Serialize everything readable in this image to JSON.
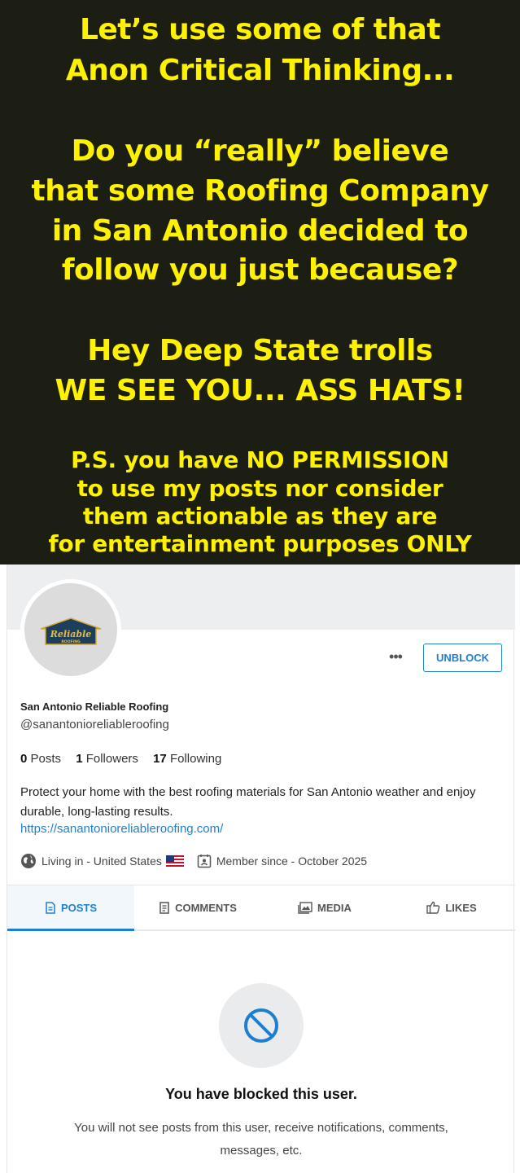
{
  "meme": {
    "line1": "Let’s use some of that",
    "line2": "Anon Critical Thinking...",
    "line3": "Do you “really” believe",
    "line4": "that some Roofing Company",
    "line5": "in San Antonio decided to",
    "line6": "follow you just because?",
    "line7": "Hey Deep State trolls",
    "line8": "WE SEE YOU... ASS HATS!",
    "line9": "P.S.  you have NO PERMISSION",
    "line10": "to use my posts nor consider",
    "line11": "them actionable as they are",
    "line12": "for entertainment purposes ONLY"
  },
  "profile": {
    "logo_text": "Reliable",
    "logo_subtext": "ROOFING",
    "more_label": "•••",
    "unblock_label": "UNBLOCK",
    "display_name": "San Antonio Reliable Roofing",
    "handle": "@sanantonioreliableroofing",
    "stats": {
      "posts_count": "0",
      "posts_label": "Posts",
      "followers_count": "1",
      "followers_label": "Followers",
      "following_count": "17",
      "following_label": "Following"
    },
    "bio": "Protect your home with the best roofing materials for San Antonio weather and enjoy durable, long-lasting results.",
    "website": "https://sanantonioreliableroofing.com/",
    "location": "Living in - United States",
    "member_since": "Member since - October 2025"
  },
  "tabs": [
    {
      "label": "POSTS",
      "icon": "document-icon",
      "active": true
    },
    {
      "label": "COMMENTS",
      "icon": "comment-doc-icon",
      "active": false
    },
    {
      "label": "MEDIA",
      "icon": "image-icon",
      "active": false
    },
    {
      "label": "LIKES",
      "icon": "thumbs-up-icon",
      "active": false
    }
  ],
  "blocked": {
    "title": "You have blocked this user.",
    "description": "You will not see posts from this user, receive notifications, comments, messages, etc."
  },
  "colors": {
    "meme_bg": "#1c1d13",
    "meme_text": "#fff200",
    "accent": "#1e7fd1"
  }
}
